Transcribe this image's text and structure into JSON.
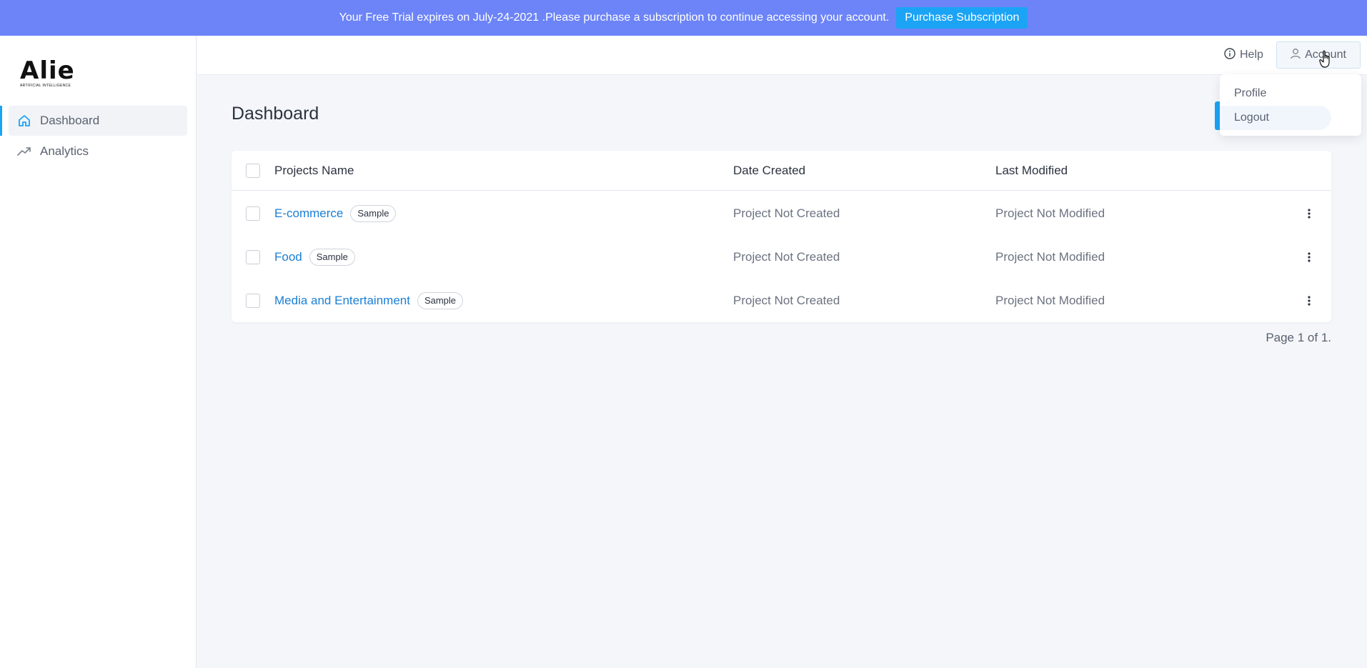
{
  "banner": {
    "message": "Your Free Trial expires on July-24-2021 .Please purchase a subscription to continue accessing your account.",
    "button_label": "Purchase Subscription"
  },
  "logo": {
    "main": "Alie",
    "sub": "ARTIFICIAL INTELLIGENCE"
  },
  "sidebar": {
    "items": [
      {
        "label": "Dashboard",
        "icon": "home-icon",
        "active": true
      },
      {
        "label": "Analytics",
        "icon": "trending-up-icon",
        "active": false
      }
    ]
  },
  "header": {
    "help_label": "Help",
    "account_label": "Account"
  },
  "account_menu": {
    "items": [
      {
        "label": "Profile"
      },
      {
        "label": "Logout"
      }
    ]
  },
  "main": {
    "title": "Dashboard",
    "table": {
      "columns": [
        "Projects Name",
        "Date Created",
        "Last Modified"
      ],
      "rows": [
        {
          "name": "E-commerce",
          "badge": "Sample",
          "created": "Project Not Created",
          "modified": "Project Not Modified"
        },
        {
          "name": "Food",
          "badge": "Sample",
          "created": "Project Not Created",
          "modified": "Project Not Modified"
        },
        {
          "name": "Media and Entertainment",
          "badge": "Sample",
          "created": "Project Not Created",
          "modified": "Project Not Modified"
        }
      ]
    },
    "pagination": "Page 1 of 1."
  },
  "colors": {
    "banner_bg": "#6c84f7",
    "accent": "#1ba3f5",
    "link": "#1a7fd6"
  }
}
